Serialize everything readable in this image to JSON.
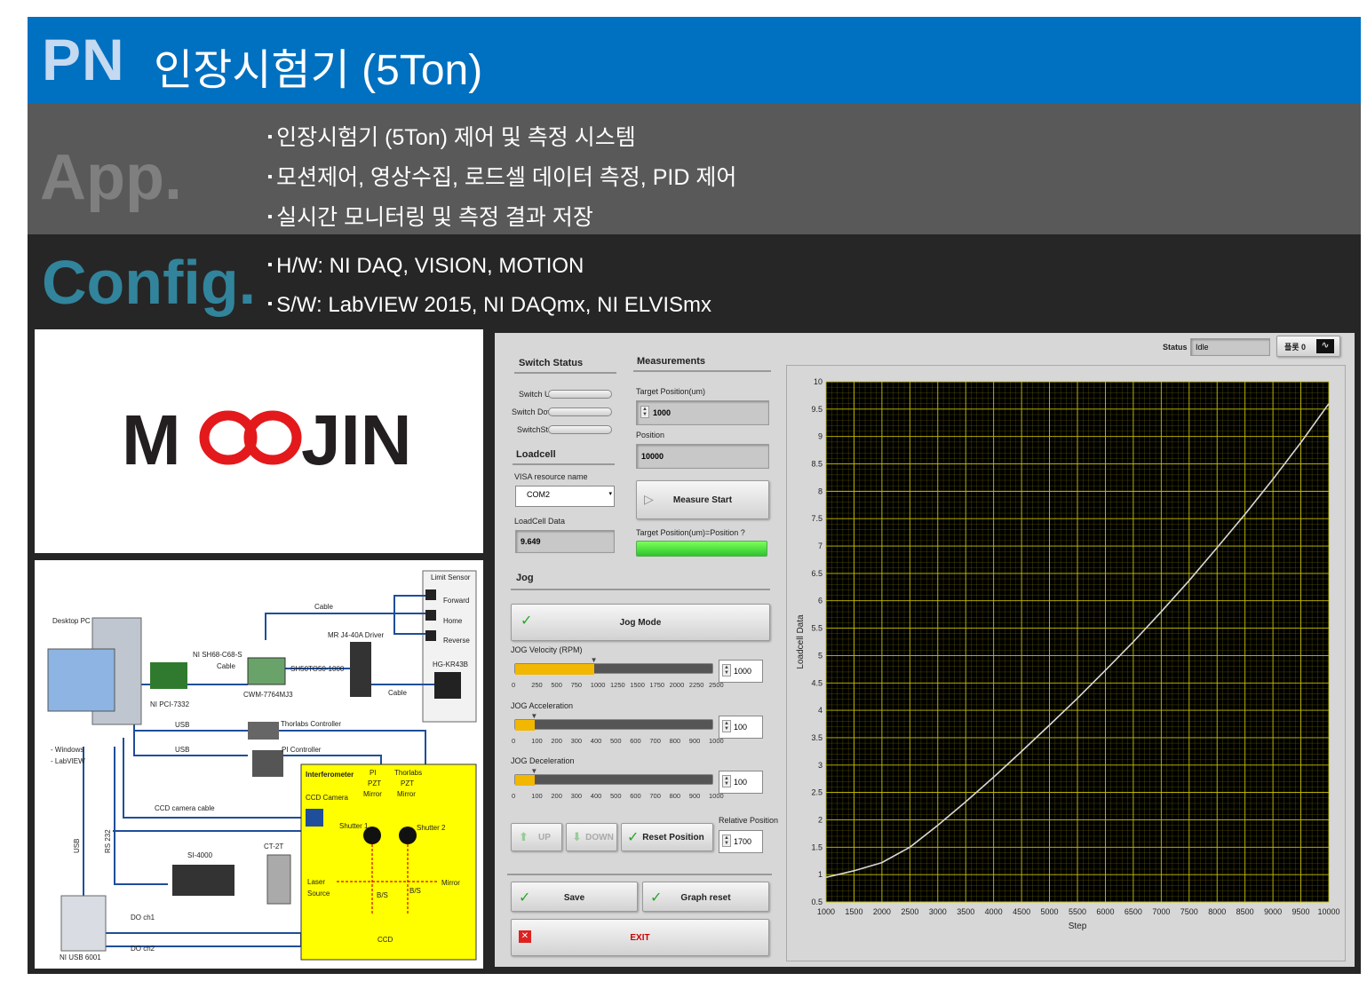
{
  "header": {
    "pn": "PN",
    "title": "인장시험기 (5Ton)"
  },
  "app": {
    "label": "App.",
    "bullets": [
      "인장시험기 (5Ton) 제어 및 측정 시스템",
      "모션제어, 영상수집, 로드셀 데이터 측정, PID 제어",
      "실시간 모니터링 및 측정 결과 저장"
    ]
  },
  "config": {
    "label": "Config.",
    "bullets": [
      "H/W: NI DAQ, VISION, MOTION",
      "S/W: LabVIEW 2015, NI DAQmx, NI ELVISmx"
    ]
  },
  "logo": {
    "text_left": "M",
    "text_right": "JIN",
    "color_red": "#e3191c",
    "color_dark": "#231f20"
  },
  "diagram": {
    "limit_sensor": "Limit Sensor",
    "forward": "Forward",
    "home": "Home",
    "reverse": "Reverse",
    "cable1": "Cable",
    "cable2": "Cable",
    "cable3": "Cable",
    "driver": "MR J4-40A Driver",
    "motor": "HG-KR43B",
    "desktop": "Desktop PC",
    "sh68": "NI SH68-C68-S",
    "sh50": "SH50TO50-1000",
    "cwm": "CWM-7764MJ3",
    "pci": "NI PCI-7332",
    "usb1": "USB",
    "usb2": "USB",
    "thorlabs_ctrl": "Thorlabs Controller",
    "pi_ctrl": "PI Controller",
    "windows": "- Windows",
    "labview": "- LabVIEW",
    "ccd_cable": "CCD camera cable",
    "usb_v": "USB",
    "rs232": "RS 232",
    "si4000": "SI-4000",
    "ct2t": "CT-2T",
    "do1": "DO ch1",
    "do2": "DO ch2",
    "niusb": "NI USB 6001",
    "interferometer": "Interferometer",
    "pi_pzt": [
      "PI",
      "PZT",
      "Mirror"
    ],
    "th_pzt": [
      "Thorlabs",
      "PZT",
      "Mirror"
    ],
    "ccd_camera": "CCD Camera",
    "shutter1": "Shutter 1",
    "shutter2": "Shutter 2",
    "laser": [
      "Laser",
      "Source"
    ],
    "bs1": "B/S",
    "bs2": "B/S",
    "mirror": "Mirror",
    "ccd": "CCD"
  },
  "lv": {
    "status_label": "Status",
    "status_value": "Idle",
    "plot_label": "플롯 0",
    "switch_status": "Switch Status",
    "switch_up": "Switch UP",
    "switch_down": "Switch Down",
    "switch_stop": "SwitchStop",
    "loadcell": "Loadcell",
    "visa_label": "VISA resource name",
    "visa_value": "COM2",
    "loadcell_data_label": "LoadCell Data",
    "loadcell_data": "9.649",
    "measurements": "Measurements",
    "target_label": "Target Position(um)",
    "target_value": "1000",
    "position_label": "Position",
    "position_value": "10000",
    "measure_start": "Measure Start",
    "target_eq": "Target Position(um)=Position ?",
    "jog": "Jog",
    "jog_mode": "Jog Mode",
    "sliders": [
      {
        "label": "JOG Velocity (RPM)",
        "value": "1000",
        "ticks": [
          "0",
          "250",
          "500",
          "750",
          "1000",
          "1250",
          "1500",
          "1750",
          "2000",
          "2250",
          "2500"
        ],
        "fill": 0.4
      },
      {
        "label": "JOG Acceleration",
        "value": "100",
        "ticks": [
          "0",
          "100",
          "200",
          "300",
          "400",
          "500",
          "600",
          "700",
          "800",
          "900",
          "1000"
        ],
        "fill": 0.1
      },
      {
        "label": "JOG Deceleration",
        "value": "100",
        "ticks": [
          "0",
          "100",
          "200",
          "300",
          "400",
          "500",
          "600",
          "700",
          "800",
          "900",
          "1000"
        ],
        "fill": 0.1
      }
    ],
    "up": "UP",
    "down": "DOWN",
    "reset_position": "Reset Position",
    "relative_label": "Relative Position",
    "relative_value": "1700",
    "save": "Save",
    "graph_reset": "Graph reset",
    "exit": "EXIT"
  },
  "chart_data": {
    "type": "line",
    "xlabel": "Step",
    "ylabel": "Loadcell Data",
    "xlim": [
      1000,
      10000
    ],
    "ylim": [
      0.5,
      10
    ],
    "xticks": [
      1000,
      1500,
      2000,
      2500,
      3000,
      3500,
      4000,
      4500,
      5000,
      5500,
      6000,
      6500,
      7000,
      7500,
      8000,
      8500,
      9000,
      9500,
      10000
    ],
    "yticks": [
      0.5,
      1,
      1.5,
      2,
      2.5,
      3,
      3.5,
      4,
      4.5,
      5,
      5.5,
      6,
      6.5,
      7,
      7.5,
      8,
      8.5,
      9,
      9.5,
      10
    ],
    "grid": true,
    "series": [
      {
        "x": [
          1000,
          1500,
          2000,
          2500,
          3000,
          3500,
          4000,
          4500,
          5000,
          5500,
          6000,
          6500,
          7000,
          7500,
          8000,
          8500,
          9000,
          9500,
          10000
        ],
        "values": [
          0.95,
          1.07,
          1.22,
          1.5,
          1.9,
          2.33,
          2.78,
          3.25,
          3.73,
          4.22,
          4.73,
          5.25,
          5.8,
          6.37,
          6.97,
          7.58,
          8.22,
          8.89,
          9.6
        ]
      }
    ],
    "colors": {
      "background": "#000000",
      "grid": "#8f8a00",
      "line": "#d8d8d8"
    }
  }
}
